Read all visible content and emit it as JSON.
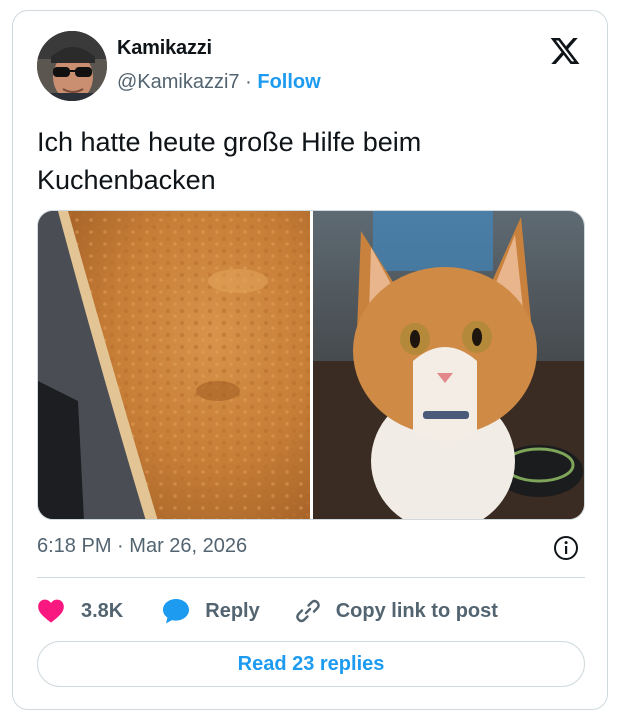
{
  "author": {
    "name": "Kamikazzi",
    "handle": "@Kamikazzi7",
    "separator": "·",
    "follow_label": "Follow"
  },
  "tweet": {
    "text": "Ich hatte heute große Hilfe beim Kuchenbacken",
    "time": "6:18 PM",
    "separator": "·",
    "date": "Mar 26, 2026"
  },
  "media": [
    {
      "subject": "cake-photo"
    },
    {
      "subject": "cat-photo"
    }
  ],
  "actions": {
    "likes": "3.8K",
    "reply_label": "Reply",
    "copy_link_label": "Copy link to post"
  },
  "footer": {
    "read_replies_label": "Read 23 replies"
  },
  "colors": {
    "accent": "#1d9bf0",
    "like": "#f91880",
    "muted": "#536471",
    "border": "#cfd9de"
  },
  "icons": [
    "x-logo-icon",
    "info-icon",
    "heart-icon",
    "reply-bubble-icon",
    "link-icon"
  ]
}
